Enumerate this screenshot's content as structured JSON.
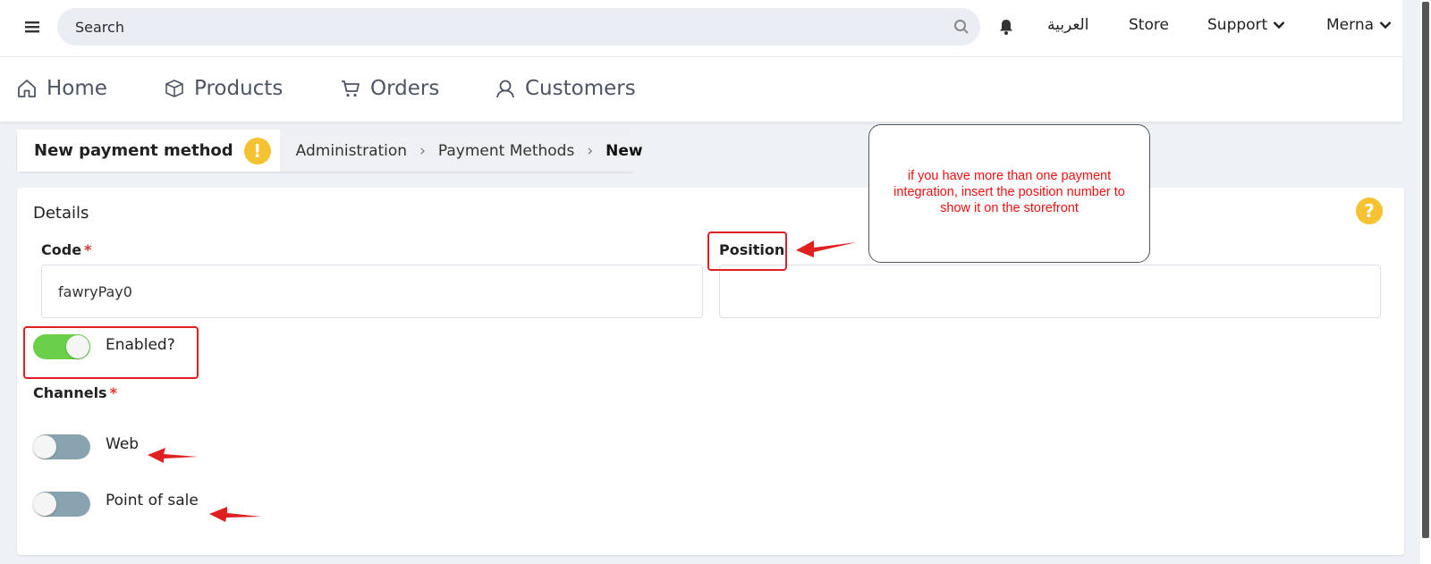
{
  "topbar": {
    "search_placeholder": "Search",
    "language": "العربية",
    "store": "Store",
    "support": "Support",
    "user": "Merna"
  },
  "nav": {
    "items": [
      {
        "label": "Home",
        "icon": "home-icon"
      },
      {
        "label": "Products",
        "icon": "box-icon"
      },
      {
        "label": "Orders",
        "icon": "cart-icon"
      },
      {
        "label": "Customers",
        "icon": "user-icon"
      }
    ]
  },
  "breadcrumb": {
    "title": "New payment method",
    "items": [
      "Administration",
      "Payment Methods",
      "New"
    ]
  },
  "details": {
    "title": "Details",
    "code_label": "Code",
    "code_value": "fawryPay0",
    "position_label": "Position",
    "position_value": "",
    "enabled_label": "Enabled?",
    "enabled": true,
    "channels_label": "Channels",
    "channels": [
      {
        "label": "Web",
        "enabled": false
      },
      {
        "label": "Point of sale",
        "enabled": false
      }
    ]
  },
  "annotation": {
    "callout_text": "if you have more than one payment integration, insert the position number to show it on the storefront"
  },
  "colors": {
    "accent_green": "#6ad04a",
    "toggle_off": "#8aa3b0",
    "warning_yellow": "#f5c232",
    "annotation_red": "#e02020"
  }
}
